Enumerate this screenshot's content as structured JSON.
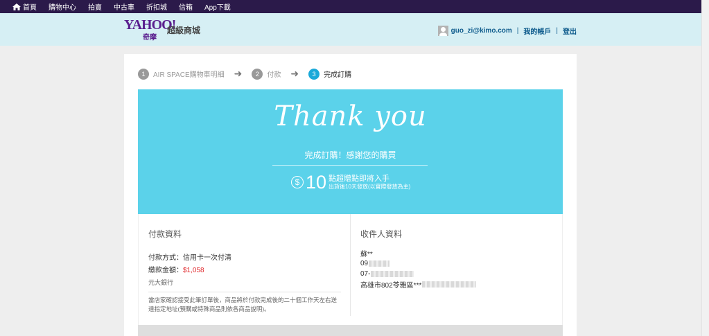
{
  "topnav": {
    "items": [
      "首頁",
      "購物中心",
      "拍賣",
      "中古車",
      "折扣城",
      "信箱",
      "App下載"
    ]
  },
  "header": {
    "logo_text": "YAHOO!",
    "logo_sub": "奇摩",
    "mall_label": "超級商城",
    "user_email": "guo_zi@kimo.com",
    "sep": "|",
    "my_account": "我的帳戶",
    "logout": "登出"
  },
  "steps": [
    {
      "num": "1",
      "label": "AIR SPACE購物車明細",
      "active": false
    },
    {
      "num": "2",
      "label": "付款",
      "active": false
    },
    {
      "num": "3",
      "label": "完成訂購",
      "active": true
    }
  ],
  "step_arrow": "➜",
  "banner": {
    "thank_you": "Thank you",
    "subtitle": "完成訂購！感謝您的購買",
    "currency_symbol": "$",
    "points": "10",
    "points_text": "點超贈點即將入手",
    "points_note": "出貨後10天發放(以實際發放為主)"
  },
  "payment": {
    "title": "付款資料",
    "method_label": "付款方式：",
    "method_value": "信用卡一次付清",
    "amount_label": "繳款金額：",
    "amount_value": "$1,058",
    "bank": "元大銀行",
    "note": "當店家確認接受此筆訂單後，商品將於付款完成後的二十個工作天左右送達指定地址(預購或特殊商品則依各商品說明)。"
  },
  "recipient": {
    "title": "收件人資料",
    "name": "蘇**",
    "mobile_prefix": "09",
    "phone_prefix": "07-",
    "address_prefix": "高雄市802苓雅區***"
  },
  "colors": {
    "topnav_bg": "#2b1a4a",
    "header_bg": "#d6eff4",
    "banner_bg": "#5bd2ea",
    "link": "#0e5b8c",
    "amount": "#e0282c",
    "step_active": "#1aa9d9"
  }
}
